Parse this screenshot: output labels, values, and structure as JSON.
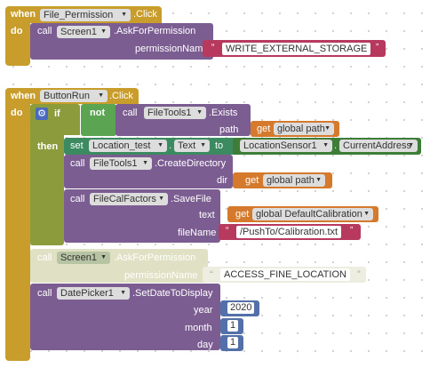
{
  "block1": {
    "when": "when",
    "component": "File_Permission",
    "event": ".Click",
    "do": "do",
    "call": "call",
    "target": "Screen1",
    "method": ".AskForPermission",
    "param": "permissionName",
    "value": "WRITE_EXTERNAL_STORAGE"
  },
  "block2": {
    "when": "when",
    "component": "ButtonRun",
    "event": ".Click",
    "do": "do",
    "if": "if",
    "then": "then",
    "not": "not",
    "exists": {
      "call": "call",
      "target": "FileTools1",
      "method": ".Exists",
      "param": "path",
      "get": "get",
      "var": "global path"
    },
    "set": {
      "set": "set",
      "target": "Location_test",
      "prop": "Text",
      "to": "to",
      "src": "LocationSensor1",
      "src_prop": "CurrentAddress"
    },
    "createdir": {
      "call": "call",
      "target": "FileTools1",
      "method": ".CreateDirectory",
      "param": "dir",
      "get": "get",
      "var": "global path"
    },
    "savefile": {
      "call": "call",
      "target": "FileCalFactors",
      "method": ".SaveFile",
      "param_text": "text",
      "get": "get",
      "var": "global DefaultCalibration",
      "param_file": "fileName",
      "file_value": "/PushTo/Calibration.txt"
    },
    "askperm2": {
      "call": "call",
      "target": "Screen1",
      "method": ".AskForPermission",
      "param": "permissionName",
      "value": "ACCESS_FINE_LOCATION"
    },
    "datepicker": {
      "call": "call",
      "target": "DatePicker1",
      "method": ".SetDateToDisplay",
      "year_label": "year",
      "year": "2020",
      "month_label": "month",
      "month": "1",
      "day_label": "day",
      "day": "1"
    }
  },
  "colors": {
    "event": "#c89d2c",
    "procedure": "#7b5d92",
    "text": "#b8395e",
    "variable": "#d57a2d",
    "logic": "#5ba552",
    "math": "#5470a9",
    "property": "#3c8a5f"
  },
  "icons": {
    "dropdown": "chevron-down-icon",
    "gear": "gear-icon"
  }
}
